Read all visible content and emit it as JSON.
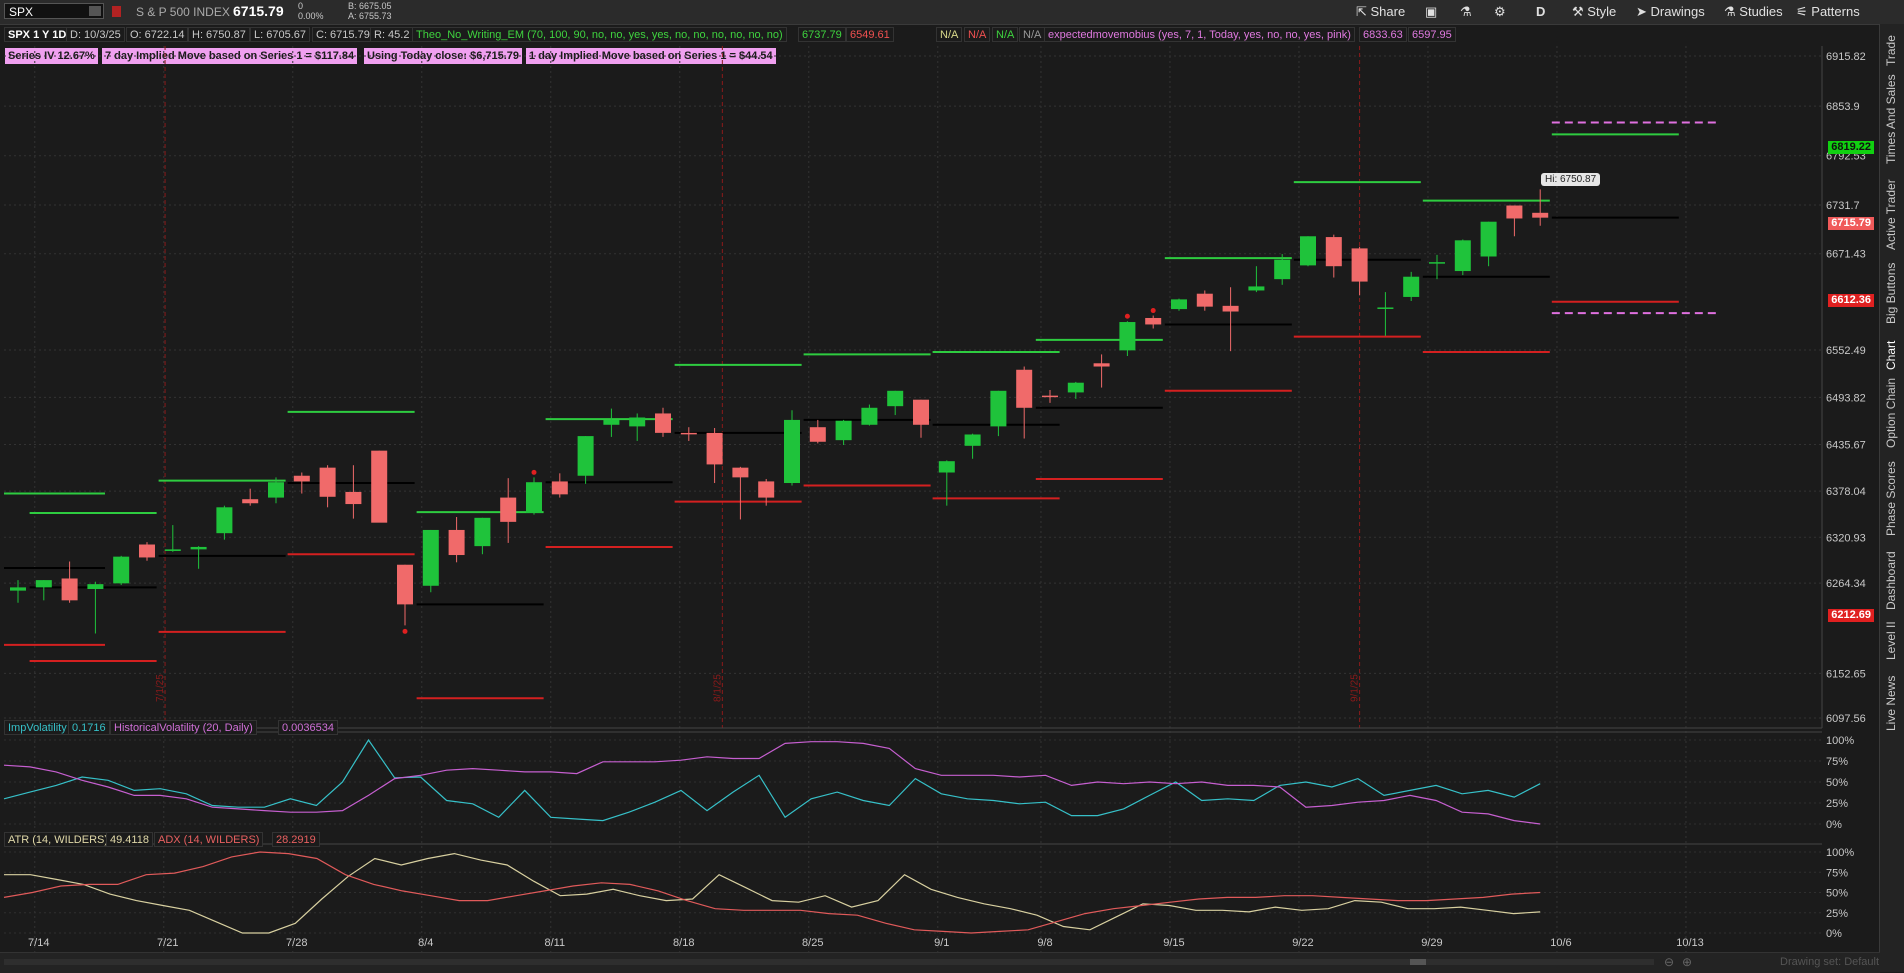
{
  "toolbar": {
    "symbol": "SPX",
    "description": "S & P 500 INDEX",
    "last": "6715.79",
    "change": "0",
    "change_pct": "0.00%",
    "bid": "B: 6675.05",
    "ask": "A: 6755.73",
    "share": "Share",
    "aggregation": "D",
    "style": "Style",
    "drawings": "Drawings",
    "studies": "Studies",
    "patterns": "Patterns"
  },
  "header": {
    "title": "SPX 1 Y 1D",
    "date": "D: 10/3/25",
    "open": "O: 6722.14",
    "high": "H: 6750.87",
    "low": "L: 6705.67",
    "close": "C: 6715.79",
    "range": "R: 45.2",
    "study1": "Theo_No_Writing_EM (70, 100, 90, no, no, yes, yes, no, no, no, no, no, no)",
    "study1_v1": "6737.79",
    "study1_v2": "6549.61",
    "na1": "N/A",
    "na2": "N/A",
    "na3": "N/A",
    "na4": "N/A",
    "study2": "expectedmovemobius (yes, 7, 1, Today, yes, no, no, yes, pink)",
    "study2_v1": "6833.63",
    "study2_v2": "6597.95"
  },
  "labels": {
    "series_iv": "Series IV 12.67%",
    "seven_day": "7 day Implied Move based on Series 1 = $117.84",
    "using_close": "Using Today close: $6,715.79",
    "one_day": "1 day Implied Move based on Series 1 = $44.54",
    "hi_label": "Hi: 6750.87"
  },
  "side_tabs": [
    "Trade",
    "Times And Sales",
    "Active Trader",
    "Big Buttons",
    "Chart",
    "Option Chain",
    "Phase Scores",
    "Dashboard",
    "Level II",
    "Live News"
  ],
  "price_boxes": {
    "green": "6819.22",
    "last": "6715.79",
    "red": "6612.36",
    "low": "6212.69"
  },
  "vol_panel": {
    "iv_label": "ImpVolatility",
    "iv_value": "0.1716",
    "hv_label": "HistoricalVolatility (20, Daily)",
    "hv_value": "0.0036534"
  },
  "atr_panel": {
    "atr_label": "ATR (14, WILDERS)",
    "atr_value": "49.4118",
    "adx_label": "ADX (14, WILDERS)",
    "adx_value": "28.2919"
  },
  "bottom": {
    "drawing_set": "Drawing set: Default"
  },
  "colors": {
    "up": "#1fc33b",
    "down": "#f06a6a",
    "green_line": "#2ecc40",
    "red_line": "#d42020",
    "pink": "#e070e0",
    "iv": "#36c0c8",
    "hv": "#c65fd0",
    "atr": "#d8d0a0",
    "adx": "#e05a5a"
  },
  "chart_data": [
    {
      "type": "candlestick",
      "title": "SPX 1 Y 1D",
      "x_ticks": [
        "7/14",
        "7/21",
        "7/28",
        "8/4",
        "8/11",
        "8/18",
        "8/25",
        "9/1",
        "9/8",
        "9/15",
        "9/22",
        "9/29",
        "10/6",
        "10/13"
      ],
      "y_ticks": [
        6097.56,
        6152.65,
        6264.34,
        6320.93,
        6378.04,
        6435.67,
        6493.82,
        6552.49,
        6671.43,
        6731.7,
        6792.53,
        6853.9,
        6915.82
      ],
      "ylim": [
        6097.56,
        6915.82
      ],
      "week_markers": [
        "7/1/25",
        "8/1/25",
        "9/1/25"
      ],
      "candles": [
        {
          "d": "7/11",
          "o": 6255,
          "h": 6268,
          "l": 6240,
          "c": 6259
        },
        {
          "d": "7/14",
          "o": 6259,
          "h": 6268,
          "l": 6243,
          "c": 6268
        },
        {
          "d": "7/15",
          "o": 6270,
          "h": 6291,
          "l": 6240,
          "c": 6243
        },
        {
          "d": "7/16",
          "o": 6257,
          "h": 6266,
          "l": 6202,
          "c": 6263
        },
        {
          "d": "7/17",
          "o": 6264,
          "h": 6298,
          "l": 6262,
          "c": 6297
        },
        {
          "d": "7/18",
          "o": 6312,
          "h": 6315,
          "l": 6292,
          "c": 6296
        },
        {
          "d": "7/21",
          "o": 6304,
          "h": 6336,
          "l": 6303,
          "c": 6306
        },
        {
          "d": "7/22",
          "o": 6306,
          "h": 6310,
          "l": 6282,
          "c": 6309
        },
        {
          "d": "7/23",
          "o": 6326,
          "h": 6360,
          "l": 6318,
          "c": 6358
        },
        {
          "d": "7/24",
          "o": 6368,
          "h": 6381,
          "l": 6360,
          "c": 6363
        },
        {
          "d": "7/25",
          "o": 6370,
          "h": 6395,
          "l": 6363,
          "c": 6389
        },
        {
          "d": "7/28",
          "o": 6397,
          "h": 6401,
          "l": 6375,
          "c": 6390
        },
        {
          "d": "7/29",
          "o": 6407,
          "h": 6410,
          "l": 6358,
          "c": 6371
        },
        {
          "d": "7/30",
          "o": 6377,
          "h": 6410,
          "l": 6344,
          "c": 6362
        },
        {
          "d": "7/31",
          "o": 6428,
          "h": 6428,
          "l": 6340,
          "c": 6339
        },
        {
          "d": "8/1",
          "o": 6287,
          "h": 6287,
          "l": 6212,
          "c": 6238
        },
        {
          "d": "8/4",
          "o": 6261,
          "h": 6330,
          "l": 6253,
          "c": 6330
        },
        {
          "d": "8/5",
          "o": 6330,
          "h": 6346,
          "l": 6290,
          "c": 6299
        },
        {
          "d": "8/6",
          "o": 6310,
          "h": 6345,
          "l": 6300,
          "c": 6345
        },
        {
          "d": "8/7",
          "o": 6370,
          "h": 6394,
          "l": 6314,
          "c": 6340
        },
        {
          "d": "8/8",
          "o": 6351,
          "h": 6395,
          "l": 6349,
          "c": 6389
        },
        {
          "d": "8/11",
          "o": 6390,
          "h": 6400,
          "l": 6370,
          "c": 6374
        },
        {
          "d": "8/12",
          "o": 6397,
          "h": 6446,
          "l": 6387,
          "c": 6446
        },
        {
          "d": "8/13",
          "o": 6460,
          "h": 6480,
          "l": 6445,
          "c": 6466
        },
        {
          "d": "8/14",
          "o": 6458,
          "h": 6474,
          "l": 6440,
          "c": 6469
        },
        {
          "d": "8/15",
          "o": 6474,
          "h": 6481,
          "l": 6445,
          "c": 6450
        },
        {
          "d": "8/18",
          "o": 6450,
          "h": 6457,
          "l": 6440,
          "c": 6449
        },
        {
          "d": "8/19",
          "o": 6450,
          "h": 6456,
          "l": 6388,
          "c": 6411
        },
        {
          "d": "8/20",
          "o": 6407,
          "h": 6408,
          "l": 6343,
          "c": 6395
        },
        {
          "d": "8/21",
          "o": 6390,
          "h": 6393,
          "l": 6360,
          "c": 6370
        },
        {
          "d": "8/22",
          "o": 6388,
          "h": 6478,
          "l": 6385,
          "c": 6466
        },
        {
          "d": "8/25",
          "o": 6457,
          "h": 6466,
          "l": 6437,
          "c": 6439
        },
        {
          "d": "8/26",
          "o": 6441,
          "h": 6466,
          "l": 6435,
          "c": 6465
        },
        {
          "d": "8/27",
          "o": 6460,
          "h": 6485,
          "l": 6459,
          "c": 6481
        },
        {
          "d": "8/28",
          "o": 6483,
          "h": 6502,
          "l": 6472,
          "c": 6502
        },
        {
          "d": "8/29",
          "o": 6491,
          "h": 6491,
          "l": 6444,
          "c": 6460
        },
        {
          "d": "9/2",
          "o": 6401,
          "h": 6416,
          "l": 6360,
          "c": 6415
        },
        {
          "d": "9/3",
          "o": 6434,
          "h": 6449,
          "l": 6418,
          "c": 6448
        },
        {
          "d": "9/4",
          "o": 6458,
          "h": 6502,
          "l": 6446,
          "c": 6502
        },
        {
          "d": "9/5",
          "o": 6528,
          "h": 6532,
          "l": 6443,
          "c": 6481
        },
        {
          "d": "9/8",
          "o": 6496,
          "h": 6503,
          "l": 6487,
          "c": 6495
        },
        {
          "d": "9/9",
          "o": 6500,
          "h": 6513,
          "l": 6492,
          "c": 6512
        },
        {
          "d": "9/10",
          "o": 6536,
          "h": 6547,
          "l": 6506,
          "c": 6532
        },
        {
          "d": "9/11",
          "o": 6552,
          "h": 6588,
          "l": 6545,
          "c": 6587
        },
        {
          "d": "9/12",
          "o": 6592,
          "h": 6595,
          "l": 6579,
          "c": 6584
        },
        {
          "d": "9/15",
          "o": 6603,
          "h": 6616,
          "l": 6601,
          "c": 6615
        },
        {
          "d": "9/16",
          "o": 6622,
          "h": 6626,
          "l": 6601,
          "c": 6606
        },
        {
          "d": "9/17",
          "o": 6607,
          "h": 6630,
          "l": 6551,
          "c": 6600
        },
        {
          "d": "9/18",
          "o": 6626,
          "h": 6656,
          "l": 6624,
          "c": 6631
        },
        {
          "d": "9/19",
          "o": 6640,
          "h": 6671,
          "l": 6633,
          "c": 6664
        },
        {
          "d": "9/22",
          "o": 6657,
          "h": 6693,
          "l": 6656,
          "c": 6693
        },
        {
          "d": "9/23",
          "o": 6692,
          "h": 6695,
          "l": 6642,
          "c": 6656
        },
        {
          "d": "9/24",
          "o": 6678,
          "h": 6680,
          "l": 6620,
          "c": 6637
        },
        {
          "d": "9/25",
          "o": 6605,
          "h": 6624,
          "l": 6570,
          "c": 6605
        },
        {
          "d": "9/26",
          "o": 6618,
          "h": 6649,
          "l": 6613,
          "c": 6643
        },
        {
          "d": "9/29",
          "o": 6661,
          "h": 6670,
          "l": 6640,
          "c": 6661
        },
        {
          "d": "9/30",
          "o": 6650,
          "h": 6689,
          "l": 6645,
          "c": 6688
        },
        {
          "d": "10/1",
          "o": 6668,
          "h": 6711,
          "l": 6656,
          "c": 6711
        },
        {
          "d": "10/2",
          "o": 6731,
          "h": 6731,
          "l": 6693,
          "c": 6715
        },
        {
          "d": "10/3",
          "o": 6722,
          "h": 6751,
          "l": 6706,
          "c": 6716
        }
      ],
      "weekly_levels": [
        {
          "week": "7/7",
          "upper": 6375,
          "mid": 6283,
          "lower": 6188
        },
        {
          "week": "7/14",
          "upper": 6351,
          "mid": 6259,
          "lower": 6168
        },
        {
          "week": "7/21",
          "upper": 6391,
          "mid": 6298,
          "lower": 6204
        },
        {
          "week": "7/28",
          "upper": 6476,
          "mid": 6388,
          "lower": 6300
        },
        {
          "week": "8/4",
          "upper": 6352,
          "mid": 6238,
          "lower": 6122
        },
        {
          "week": "8/11",
          "upper": 6467,
          "mid": 6389,
          "lower": 6309
        },
        {
          "week": "8/18",
          "upper": 6534,
          "mid": 6450,
          "lower": 6365
        },
        {
          "week": "8/25",
          "upper": 6547,
          "mid": 6466,
          "lower": 6385
        },
        {
          "week": "9/1",
          "upper": 6550,
          "mid": 6460,
          "lower": 6369
        },
        {
          "week": "9/8",
          "upper": 6565,
          "mid": 6481,
          "lower": 6393
        },
        {
          "week": "9/15",
          "upper": 6666,
          "mid": 6584,
          "lower": 6502
        },
        {
          "week": "9/22",
          "upper": 6760,
          "mid": 6664,
          "lower": 6569
        },
        {
          "week": "9/29",
          "upper": 6737,
          "mid": 6643,
          "lower": 6550
        },
        {
          "week": "10/6",
          "upper": 6819,
          "mid": 6716,
          "lower": 6612
        }
      ],
      "expected_move": {
        "upper": 6833.63,
        "lower": 6597.95,
        "from": "10/3",
        "to": "10/9"
      },
      "arrows_down": [
        "8/1"
      ],
      "arrows_up": [
        "8/8",
        "9/11",
        "9/12"
      ]
    },
    {
      "type": "line",
      "title": "ImpVolatility / HistoricalVolatility (20, Daily)",
      "y_ticks": [
        "0%",
        "25%",
        "50%",
        "75%",
        "100%"
      ],
      "ylim": [
        0,
        100
      ],
      "series": [
        {
          "name": "ImpVolatility",
          "values": [
            30,
            38,
            46,
            56,
            52,
            40,
            42,
            36,
            22,
            20,
            20,
            30,
            22,
            50,
            100,
            55,
            56,
            28,
            24,
            8,
            40,
            8,
            6,
            4,
            14,
            26,
            40,
            16,
            38,
            58,
            8,
            30,
            38,
            28,
            22,
            54,
            36,
            30,
            28,
            24,
            26,
            10,
            10,
            18,
            34,
            50,
            28,
            30,
            28,
            46,
            50,
            44,
            54,
            34,
            40,
            46,
            36,
            40,
            32,
            48
          ]
        },
        {
          "name": "HistoricalVolatility (20, Daily)",
          "values": [
            70,
            68,
            62,
            52,
            44,
            34,
            34,
            30,
            20,
            18,
            16,
            14,
            14,
            16,
            34,
            54,
            58,
            64,
            66,
            64,
            62,
            62,
            60,
            74,
            74,
            74,
            76,
            80,
            78,
            78,
            96,
            98,
            98,
            96,
            90,
            66,
            58,
            58,
            58,
            56,
            58,
            46,
            50,
            48,
            50,
            48,
            50,
            46,
            46,
            44,
            20,
            22,
            26,
            28,
            34,
            28,
            14,
            12,
            4,
            0
          ]
        }
      ]
    },
    {
      "type": "line",
      "title": "ATR (14, WILDERS) / ADX (14, WILDERS)",
      "y_ticks": [
        "0%",
        "25%",
        "50%",
        "75%",
        "100%"
      ],
      "ylim": [
        0,
        100
      ],
      "series": [
        {
          "name": "ATR (14, WILDERS)",
          "values": [
            72,
            72,
            66,
            60,
            48,
            40,
            34,
            28,
            14,
            0,
            0,
            12,
            42,
            70,
            92,
            84,
            92,
            98,
            90,
            84,
            64,
            46,
            48,
            54,
            46,
            40,
            42,
            72,
            56,
            40,
            38,
            46,
            32,
            40,
            72,
            54,
            44,
            36,
            30,
            22,
            8,
            4,
            20,
            36,
            34,
            28,
            28,
            26,
            32,
            28,
            30,
            40,
            38,
            30,
            30,
            32,
            28,
            24,
            26
          ]
        },
        {
          "name": "ADX (14, WILDERS)",
          "values": [
            44,
            50,
            58,
            60,
            60,
            72,
            74,
            82,
            94,
            100,
            98,
            92,
            72,
            60,
            52,
            46,
            40,
            40,
            46,
            52,
            58,
            62,
            60,
            52,
            40,
            30,
            28,
            28,
            28,
            24,
            22,
            12,
            4,
            2,
            0,
            2,
            4,
            14,
            24,
            30,
            34,
            38,
            42,
            44,
            44,
            46,
            46,
            44,
            42,
            40,
            40,
            42,
            44,
            48,
            50
          ]
        }
      ]
    }
  ]
}
